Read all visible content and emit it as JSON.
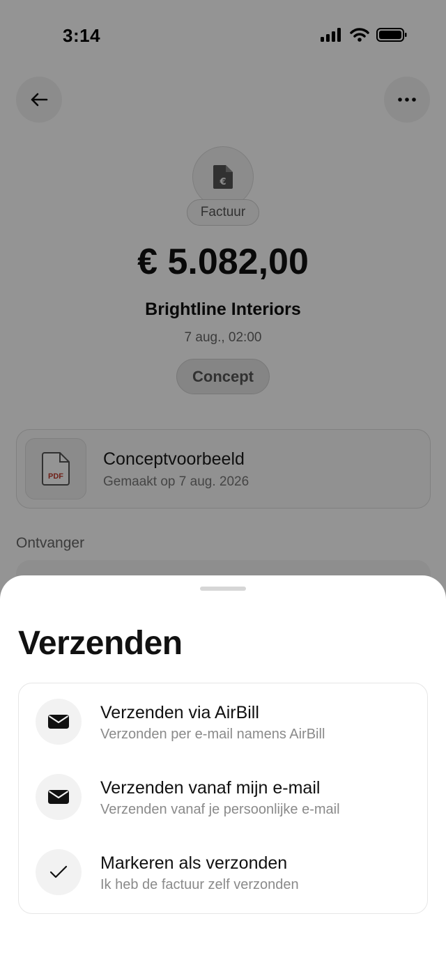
{
  "status_bar": {
    "time": "3:14"
  },
  "header": {
    "back_icon": "arrow-left-icon",
    "more_icon": "ellipsis-icon"
  },
  "invoice": {
    "type_label": "Factuur",
    "doc_icon": "euro-document-icon",
    "amount": "€ 5.082,00",
    "client": "Brightline Interiors",
    "date": "7 aug., 02:00",
    "status": "Concept"
  },
  "preview": {
    "icon": "pdf-file-icon",
    "icon_text": "PDF",
    "title": "Conceptvoorbeeld",
    "subtitle": "Gemaakt op 7 aug. 2026"
  },
  "recipient": {
    "section_label": "Ontvanger"
  },
  "sheet": {
    "title": "Verzenden",
    "options": [
      {
        "icon": "envelope-icon",
        "title": "Verzenden via AirBill",
        "subtitle": "Verzonden per e-mail namens AirBill"
      },
      {
        "icon": "envelope-icon",
        "title": "Verzenden vanaf mijn e-mail",
        "subtitle": "Verzenden vanaf je persoonlijke e-mail"
      },
      {
        "icon": "checkmark-icon",
        "title": "Markeren als verzonden",
        "subtitle": "Ik heb de factuur zelf verzonden"
      }
    ]
  },
  "colors": {
    "overlay": "#000000",
    "pdf_red": "#c0392b",
    "text_primary": "#111111",
    "text_secondary": "#8a8a8a"
  }
}
